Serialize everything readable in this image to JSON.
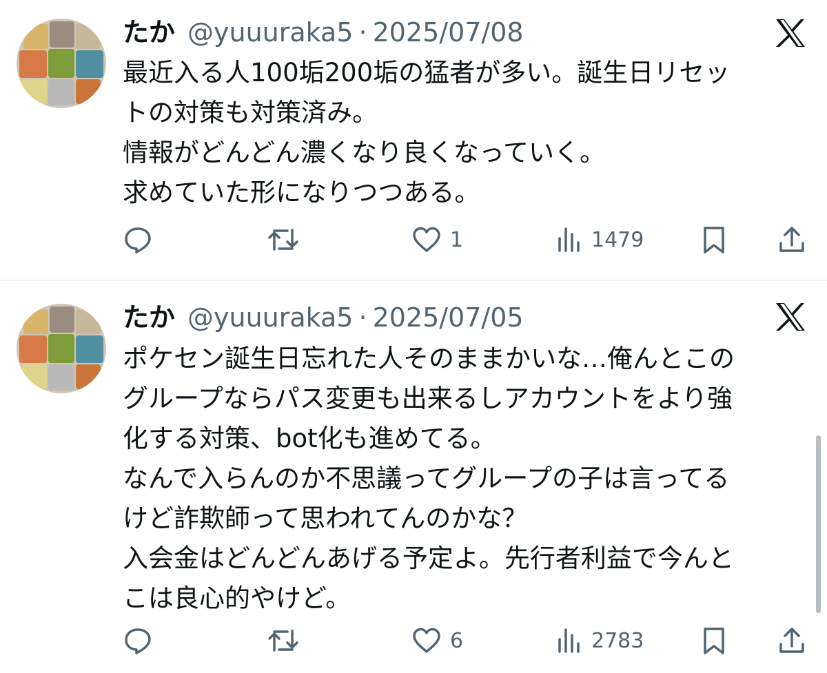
{
  "tweets": [
    {
      "author_name": "たか",
      "handle": "@yuuuraka5",
      "separator": "·",
      "date": "2025/07/08",
      "text_lines": [
        "最近入る人100垢200垢の猛者が多い。誕生日リセッ",
        "トの対策も対策済み。",
        "情報がどんどん濃くなり良くなっていく。",
        "求めていた形になりつつある。"
      ],
      "actions": {
        "reply_icon": "reply-bubble-icon",
        "retweet_icon": "retweet-arrows-icon",
        "like_icon": "heart-icon",
        "likes": "1",
        "views_icon": "bar-chart-icon",
        "views": "1479",
        "bookmark_icon": "bookmark-icon",
        "share_icon": "share-upload-icon"
      }
    },
    {
      "author_name": "たか",
      "handle": "@yuuuraka5",
      "separator": "·",
      "date": "2025/07/05",
      "text_lines": [
        "ポケセン誕生日忘れた人そのままかいな…俺んとこの",
        "グループならパス変更も出来るしアカウントをより強",
        "化する対策、bot化も進めてる。",
        "なんで入らんのか不思議ってグループの子は言ってる",
        "けど詐欺師って思われてんのかな？",
        "入会金はどんどんあげる予定よ。先行者利益で今んと",
        "こは良心的やけど。"
      ],
      "actions": {
        "reply_icon": "reply-bubble-icon",
        "retweet_icon": "retweet-arrows-icon",
        "like_icon": "heart-icon",
        "likes": "6",
        "views_icon": "bar-chart-icon",
        "views": "2783",
        "bookmark_icon": "bookmark-icon",
        "share_icon": "share-upload-icon"
      }
    }
  ],
  "brand_icon": "x-logo-icon",
  "colors": {
    "text_primary": "#0f1419",
    "text_secondary": "#536471",
    "divider": "#eff3f4",
    "background": "#ffffff"
  }
}
